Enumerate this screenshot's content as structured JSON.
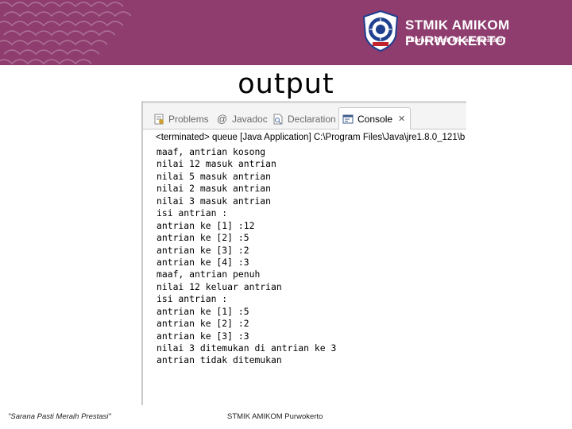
{
  "header": {
    "brand_name": "STMIK AMIKOM PURWOKERTO",
    "tagline": "\"Sarana Pasti Meraih Prestasi\"",
    "background_color": "#8e3d6e",
    "seal_lettering": "AMIKOM"
  },
  "slide": {
    "title": "output"
  },
  "console_view": {
    "tabs": [
      {
        "label": "Problems",
        "icon": "problems-icon",
        "active": false
      },
      {
        "label": "Javadoc",
        "icon": "at-sign-icon",
        "active": false
      },
      {
        "label": "Declaration",
        "icon": "declaration-icon",
        "active": false
      },
      {
        "label": "Console",
        "icon": "console-icon",
        "active": true
      }
    ],
    "close_icon": "close-icon",
    "status_line": "<terminated> queue [Java Application] C:\\Program Files\\Java\\jre1.8.0_121\\b",
    "output_lines": [
      "maaf, antrian kosong",
      "nilai 12 masuk antrian",
      "nilai 5 masuk antrian",
      "nilai 2 masuk antrian",
      "nilai 3 masuk antrian",
      "isi antrian :",
      "antrian ke [1] :12",
      "antrian ke [2] :5",
      "antrian ke [3] :2",
      "antrian ke [4] :3",
      "maaf, antrian penuh",
      "nilai 12 keluar antrian",
      "isi antrian :",
      "antrian ke [1] :5",
      "antrian ke [2] :2",
      "antrian ke [3] :3",
      "nilai 3 ditemukan di antrian ke 3",
      "antrian tidak ditemukan"
    ]
  },
  "footer": {
    "tagline": "\"Sarana Pasti Meraih Prestasi\"",
    "institution": "STMIK AMIKOM Purwokerto"
  }
}
